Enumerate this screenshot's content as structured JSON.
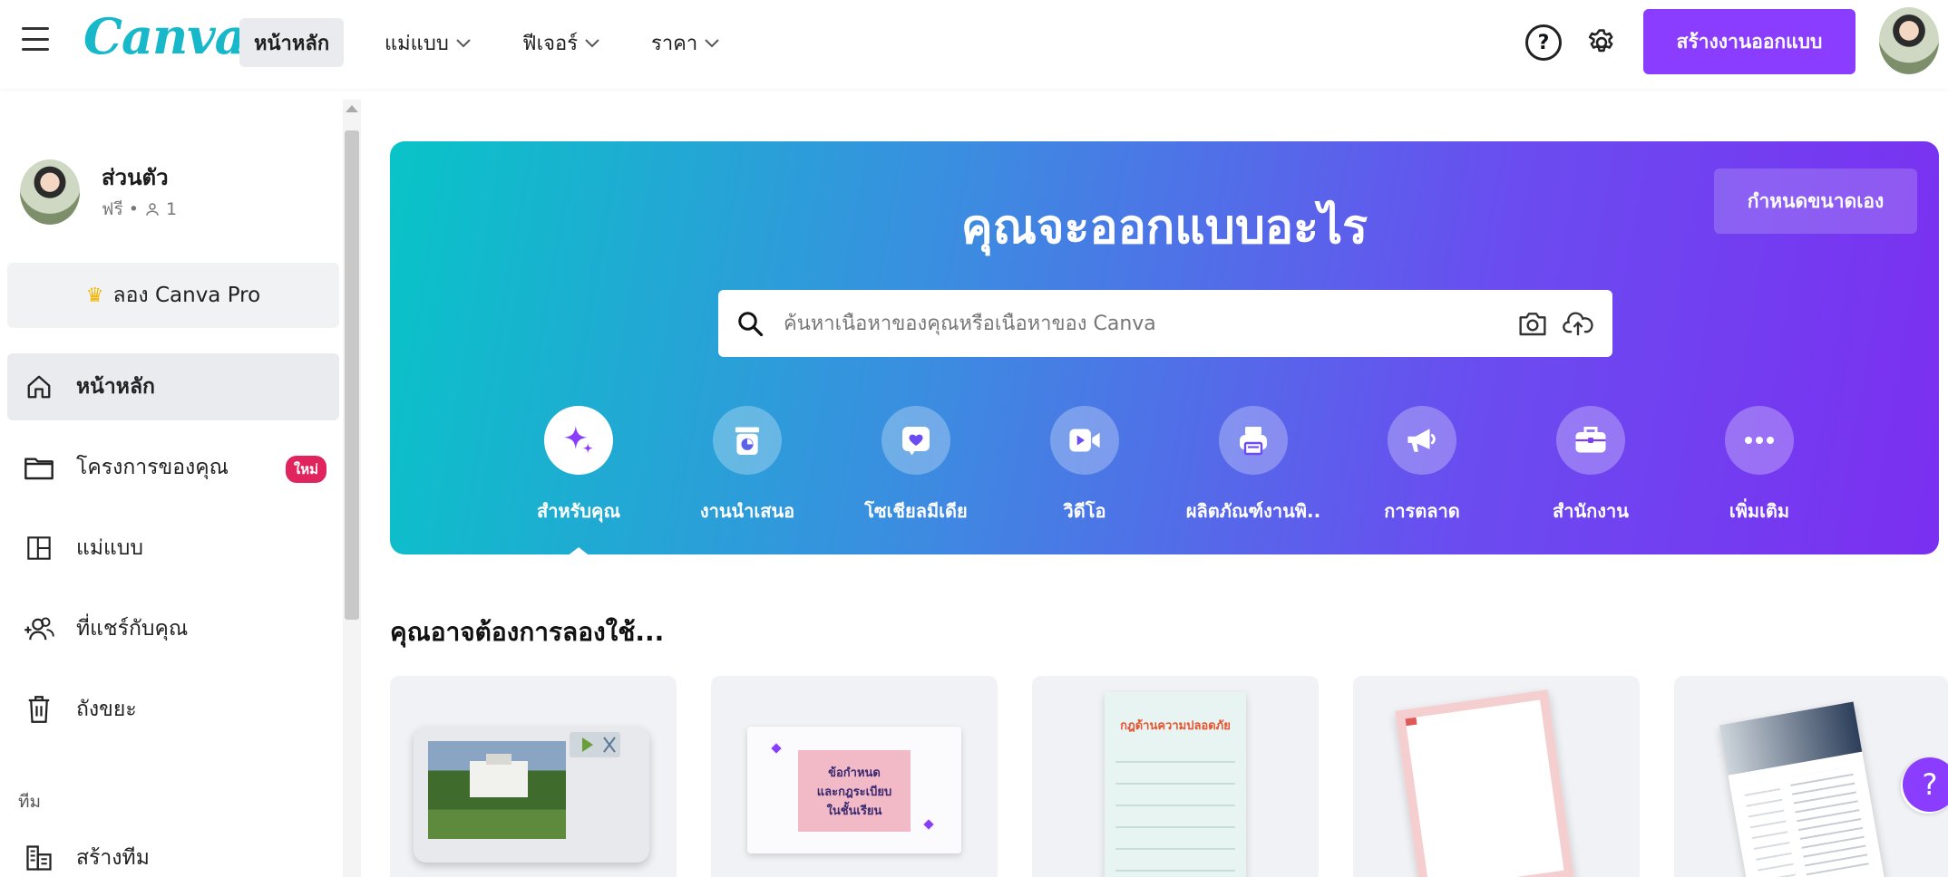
{
  "app": {
    "logo": "Canva"
  },
  "nav": {
    "items": [
      {
        "label": "หน้าหลัก",
        "active": true,
        "dropdown": false
      },
      {
        "label": "แม่แบบ",
        "active": false,
        "dropdown": true
      },
      {
        "label": "ฟีเจอร์",
        "active": false,
        "dropdown": true
      },
      {
        "label": "ราคา",
        "active": false,
        "dropdown": true
      }
    ],
    "help_icon": "question-mark-icon",
    "help_label": "?",
    "settings_icon": "gear-icon",
    "create_label": "สร้างงานออกแบบ"
  },
  "sidebar": {
    "profile": {
      "name": "ส่วนตัว",
      "meta": "ฟรี • ",
      "member_count": "1"
    },
    "try_pro": "ลอง Canva Pro",
    "items": [
      {
        "label": "หน้าหลัก",
        "icon": "home-icon",
        "active": true
      },
      {
        "label": "โครงการของคุณ",
        "icon": "folder-icon",
        "active": false,
        "badge": "ใหม่"
      },
      {
        "label": "แม่แบบ",
        "icon": "template-icon",
        "active": false
      },
      {
        "label": "ที่แชร์กับคุณ",
        "icon": "shared-users-icon",
        "active": false
      },
      {
        "label": "ถังขยะ",
        "icon": "trash-icon",
        "active": false
      }
    ],
    "team_heading": "ทีม",
    "team_items": [
      {
        "label": "สร้างทีม",
        "icon": "create-team-icon"
      }
    ]
  },
  "hero": {
    "title": "คุณจะออกแบบอะไร",
    "custom_size": "กำหนดขนาดเอง",
    "search_placeholder": "ค้นหาเนื้อหาของคุณหรือเนื้อหาของ Canva",
    "categories": [
      {
        "label": "สำหรับคุณ",
        "icon": "sparkle-icon",
        "active": true
      },
      {
        "label": "งานนำเสนอ",
        "icon": "presentation-icon",
        "active": false
      },
      {
        "label": "โซเชียลมีเดีย",
        "icon": "heart-icon",
        "active": false
      },
      {
        "label": "วิดีโอ",
        "icon": "video-camera-icon",
        "active": false
      },
      {
        "label": "ผลิตภัณฑ์งานพิ..",
        "icon": "printer-icon",
        "active": false
      },
      {
        "label": "การตลาด",
        "icon": "megaphone-icon",
        "active": false
      },
      {
        "label": "สำนักงาน",
        "icon": "briefcase-icon",
        "active": false
      },
      {
        "label": "เพิ่มเติม",
        "icon": "more-dots-icon",
        "active": false
      }
    ]
  },
  "suggestions": {
    "title": "คุณอาจต้องการลองใช้...",
    "cards": [
      {
        "name": "video-thumbnail-card"
      },
      {
        "name": "presentation-card",
        "lines": [
          "ข้อกำหนด",
          "และกฎระเบียบ",
          "ในชั้นเรียน"
        ]
      },
      {
        "name": "infographic-card",
        "heading": "กฎด้านความปลอดภัย"
      },
      {
        "name": "letterhead-card"
      },
      {
        "name": "resume-card"
      }
    ]
  },
  "floating_help": "?",
  "colors": {
    "accent": "#8b3dff",
    "logo": "#16b8c9",
    "badge": "#e0245e",
    "hero_start": "#08c4c7",
    "hero_end": "#7b2ff0"
  }
}
